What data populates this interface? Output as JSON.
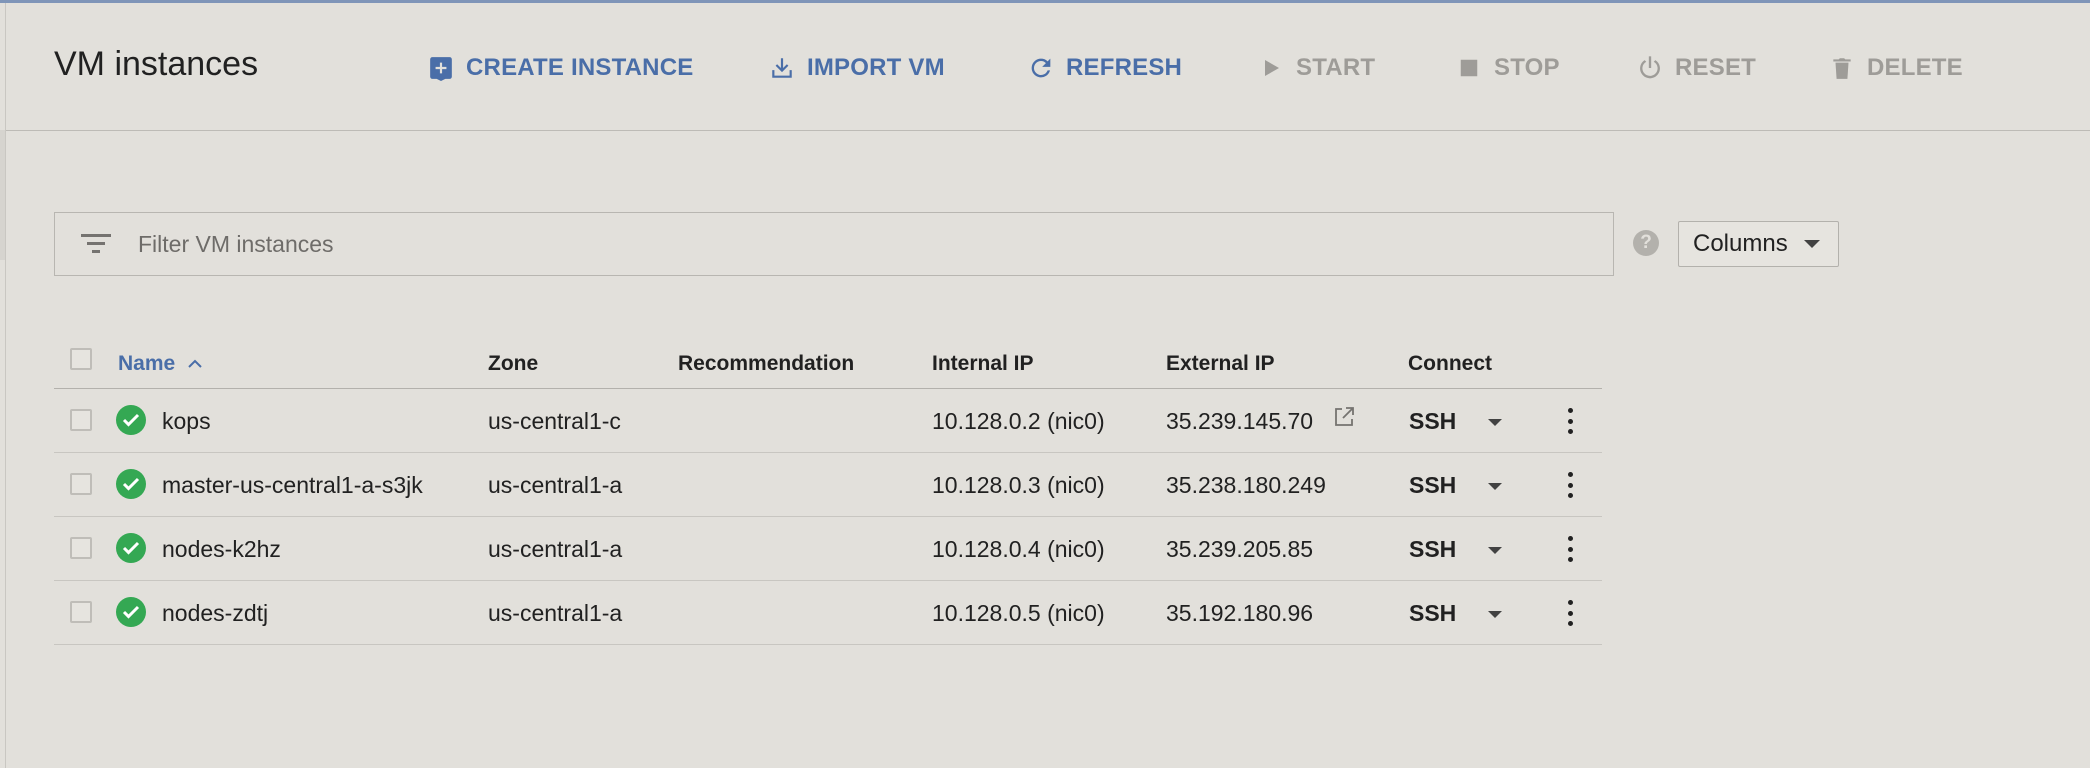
{
  "header": {
    "title": "VM instances",
    "actions": [
      {
        "label": "CREATE INSTANCE",
        "icon": "add-box-icon",
        "state": "enabled"
      },
      {
        "label": "IMPORT VM",
        "icon": "download-icon",
        "state": "enabled"
      },
      {
        "label": "REFRESH",
        "icon": "refresh-icon",
        "state": "enabled"
      },
      {
        "label": "START",
        "icon": "play-icon",
        "state": "disabled"
      },
      {
        "label": "STOP",
        "icon": "stop-icon",
        "state": "disabled"
      },
      {
        "label": "RESET",
        "icon": "power-icon",
        "state": "disabled"
      },
      {
        "label": "DELETE",
        "icon": "trash-icon",
        "state": "disabled"
      }
    ]
  },
  "filter": {
    "placeholder": "Filter VM instances",
    "value": "",
    "help_icon": "?",
    "columns_label": "Columns"
  },
  "table": {
    "columns": {
      "name": "Name",
      "zone": "Zone",
      "recommendation": "Recommendation",
      "internal_ip": "Internal IP",
      "external_ip": "External IP",
      "connect": "Connect"
    },
    "sort": {
      "column": "Name",
      "direction": "ascending"
    },
    "rows": [
      {
        "name": "kops",
        "zone": "us-central1-c",
        "recommendation": "",
        "internal_ip": "10.128.0.2 (nic0)",
        "external_ip": "35.239.145.70",
        "external_link": true,
        "connect": "SSH",
        "status": "running"
      },
      {
        "name": "master-us-central1-a-s3jk",
        "zone": "us-central1-a",
        "recommendation": "",
        "internal_ip": "10.128.0.3 (nic0)",
        "external_ip": "35.238.180.249",
        "external_link": false,
        "connect": "SSH",
        "status": "running"
      },
      {
        "name": "nodes-k2hz",
        "zone": "us-central1-a",
        "recommendation": "",
        "internal_ip": "10.128.0.4 (nic0)",
        "external_ip": "35.239.205.85",
        "external_link": false,
        "connect": "SSH",
        "status": "running"
      },
      {
        "name": "nodes-zdtj",
        "zone": "us-central1-a",
        "recommendation": "",
        "internal_ip": "10.128.0.5 (nic0)",
        "external_ip": "35.192.180.96",
        "external_link": false,
        "connect": "SSH",
        "status": "running"
      }
    ]
  },
  "colors": {
    "accent": "#4a6ea8",
    "disabled": "#9e9c98",
    "status_ok": "#34a853",
    "background": "#e2e0db"
  }
}
